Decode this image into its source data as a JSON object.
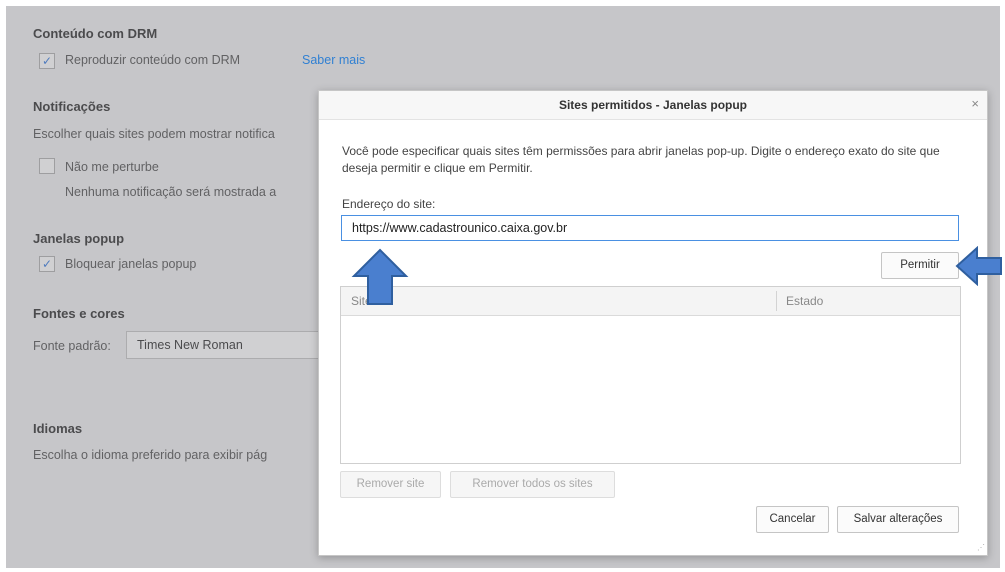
{
  "background": {
    "drm": {
      "title": "Conteúdo com DRM",
      "checkbox_label": "Reproduzir conteúdo com DRM",
      "link": "Saber mais",
      "checked": true
    },
    "notifications": {
      "title": "Notificações",
      "description": "Escolher quais sites podem mostrar notifica",
      "dnd_label": "Não me perturbe",
      "dnd_checked": false,
      "dnd_desc": "Nenhuma notificação será mostrada a"
    },
    "popups": {
      "title": "Janelas popup",
      "checkbox_label": "Bloquear janelas popup",
      "checked": true
    },
    "fonts": {
      "title": "Fontes e cores",
      "default_label": "Fonte padrão:",
      "default_value": "Times New Roman"
    },
    "languages": {
      "title": "Idiomas",
      "description": "Escolha o idioma preferido para exibir pág"
    }
  },
  "dialog": {
    "title": "Sites permitidos - Janelas popup",
    "close": "×",
    "description": "Você pode especificar quais sites têm permissões para abrir janelas pop-up. Digite o endereço exato do site que deseja permitir e clique em Permitir.",
    "address_label": "Endereço do site:",
    "address_value": "https://www.cadastrounico.caixa.gov.br",
    "allow_button": "Permitir",
    "table": {
      "columns": [
        "Site",
        "Estado"
      ],
      "rows": []
    },
    "remove_site_button": "Remover site",
    "remove_all_button": "Remover todos os sites",
    "cancel_button": "Cancelar",
    "save_button": "Salvar alterações"
  },
  "colors": {
    "accent": "#4a90e2",
    "arrow_fill": "#4a7fcf",
    "checkmark": "#3a7de0"
  },
  "icons": [
    "checkmark-icon",
    "close-icon",
    "up-arrow-annotation",
    "left-arrow-annotation",
    "resize-grip-icon"
  ]
}
